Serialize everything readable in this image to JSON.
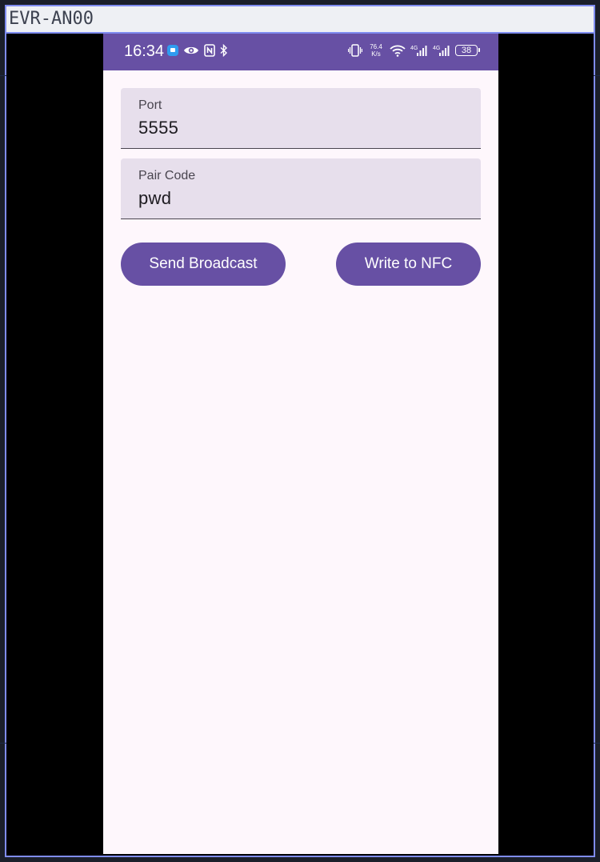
{
  "window": {
    "title": "EVR-AN00"
  },
  "status_bar": {
    "time": "16:34",
    "left_icons": [
      "message-icon",
      "eye-icon",
      "nfc-icon",
      "bluetooth-icon"
    ],
    "network_speed_value": "76.4",
    "network_speed_unit": "K/s",
    "right_icons": [
      "vibrate-icon",
      "wifi-icon",
      "signal-4g-icon",
      "signal-4g-icon"
    ],
    "signal_label_1": "4G",
    "signal_label_2": "4G",
    "battery_level": "38"
  },
  "form": {
    "port": {
      "label": "Port",
      "value": "5555"
    },
    "pair_code": {
      "label": "Pair Code",
      "value": "pwd"
    }
  },
  "actions": {
    "send_broadcast_label": "Send Broadcast",
    "write_nfc_label": "Write to NFC"
  },
  "colors": {
    "primary": "#6750a4",
    "surface": "#fef7fc",
    "field_background": "#e7dfec",
    "window_border": "#7f8cf0"
  }
}
